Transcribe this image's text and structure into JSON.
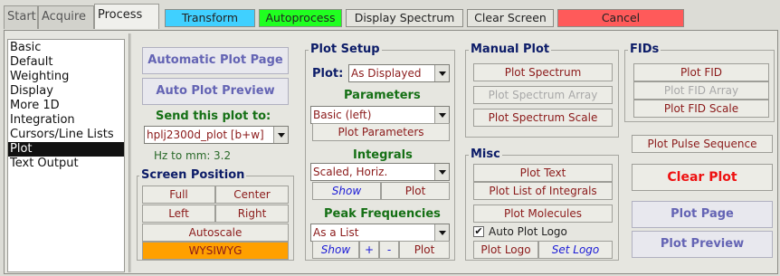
{
  "tabs": [
    {
      "label": "Start",
      "active": false
    },
    {
      "label": "Acquire",
      "active": false
    },
    {
      "label": "Process",
      "active": true
    }
  ],
  "toolbar": {
    "transform": "Transform",
    "autoprocess": "Autoprocess",
    "display_spectrum": "Display Spectrum",
    "clear_screen": "Clear Screen",
    "cancel": "Cancel"
  },
  "sidebar": {
    "items": [
      "Basic",
      "Default",
      "Weighting",
      "Display",
      "More 1D",
      "Integration",
      "Cursors/Line Lists",
      "Plot",
      "Text Output"
    ],
    "selected": "Plot"
  },
  "left": {
    "automatic_plot_page": "Automatic Plot Page",
    "auto_plot_preview": "Auto Plot Preview",
    "send_label": "Send this plot to:",
    "printer": "hplj2300d_plot [b+w]",
    "hz_to_mm": "Hz to mm:",
    "hz_value": "3.2",
    "screen_position": {
      "title": "Screen Position",
      "full": "Full",
      "center": "Center",
      "left": "Left",
      "right": "Right",
      "autoscale": "Autoscale",
      "wysiwyg": "WYSIWYG"
    }
  },
  "plot_setup": {
    "title": "Plot Setup",
    "plot_label": "Plot:",
    "plot_value": "As Displayed",
    "parameters_title": "Parameters",
    "parameters_value": "Basic (left)",
    "plot_parameters": "Plot Parameters",
    "integrals_title": "Integrals",
    "integrals_value": "Scaled, Horiz.",
    "integrals_show": "Show",
    "integrals_plot": "Plot",
    "peak_title": "Peak Frequencies",
    "peak_value": "As a List",
    "peak_show": "Show",
    "peak_plus": "+",
    "peak_minus": "-",
    "peak_plot": "Plot"
  },
  "manual_plot": {
    "title": "Manual Plot",
    "plot_spectrum": "Plot Spectrum",
    "plot_spectrum_array": "Plot Spectrum Array",
    "plot_spectrum_scale": "Plot Spectrum Scale"
  },
  "misc": {
    "title": "Misc",
    "plot_text": "Plot Text",
    "plot_list_integrals": "Plot List of Integrals",
    "plot_molecules": "Plot Molecules",
    "auto_plot_logo": "Auto Plot Logo",
    "auto_plot_logo_checked": true,
    "plot_logo": "Plot Logo",
    "set_logo": "Set Logo"
  },
  "fids": {
    "title": "FIDs",
    "plot_fid": "Plot FID",
    "plot_fid_array": "Plot FID Array",
    "plot_fid_scale": "Plot FID Scale"
  },
  "right": {
    "plot_pulse_sequence": "Plot Pulse Sequence",
    "clear_plot": "Clear Plot",
    "plot_page": "Plot Page",
    "plot_preview": "Plot Preview"
  },
  "colors": {
    "transform_bg": "#40d0ff",
    "autoprocess_bg": "#20ff20",
    "cancel_bg": "#ff5a5a",
    "wysiwyg_bg": "#ffa000",
    "selected_bg": "#111111"
  }
}
